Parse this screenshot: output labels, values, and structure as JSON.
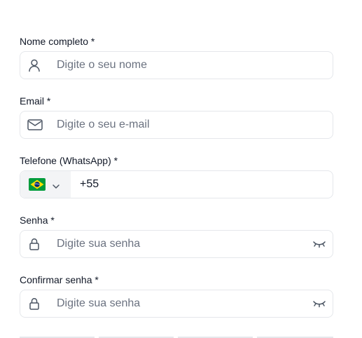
{
  "form": {
    "name": {
      "label": "Nome completo *",
      "placeholder": "Digite o seu nome",
      "icon": "user-icon"
    },
    "email": {
      "label": "Email *",
      "placeholder": "Digite o seu e-mail",
      "icon": "mail-icon"
    },
    "phone": {
      "label": "Telefone (WhatsApp) *",
      "country_flag": "brazil-flag-icon",
      "value": "+55"
    },
    "password": {
      "label": "Senha *",
      "placeholder": "Digite sua senha",
      "icon": "lock-icon",
      "toggle_icon": "eye-closed-icon"
    },
    "confirm_password": {
      "label": "Confirmar senha *",
      "placeholder": "Digite sua senha",
      "icon": "lock-icon",
      "toggle_icon": "eye-closed-icon"
    }
  },
  "colors": {
    "text": "#111827",
    "placeholder": "#6b7280",
    "border": "#e5e7eb",
    "icon": "#4b5563"
  }
}
